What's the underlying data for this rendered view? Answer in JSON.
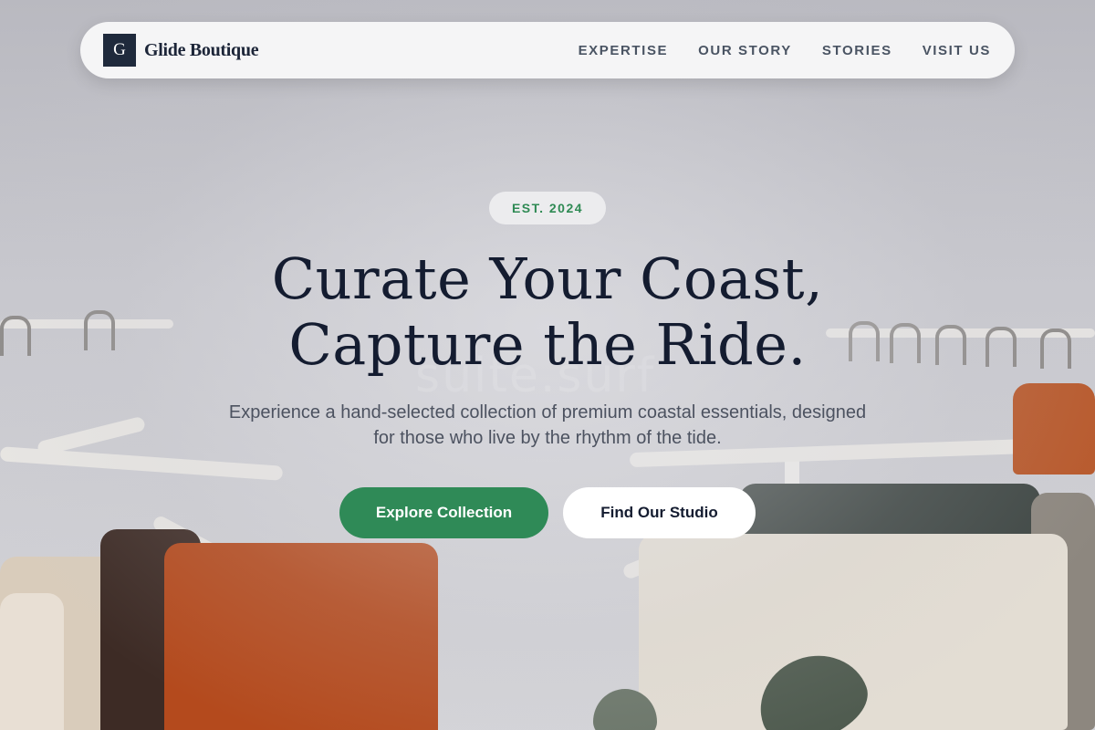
{
  "brand": {
    "logo_letter": "G",
    "name": "Glide Boutique"
  },
  "nav": {
    "items": [
      {
        "label": "EXPERTISE"
      },
      {
        "label": "OUR STORY"
      },
      {
        "label": "STORIES"
      },
      {
        "label": "VISIT US"
      }
    ]
  },
  "hero": {
    "badge": "EST. 2024",
    "headline_line1": "Curate Your Coast,",
    "headline_line2": "Capture the Ride.",
    "subtext": "Experience a hand-selected collection of premium coastal essentials, designed for those who live by the rhythm of the tide.",
    "primary_button": "Explore Collection",
    "secondary_button": "Find Our Studio",
    "background_sign": "suite.surf"
  },
  "colors": {
    "accent_green": "#2f8a57",
    "navy": "#141c30",
    "logo_bg": "#1f2a3c"
  }
}
